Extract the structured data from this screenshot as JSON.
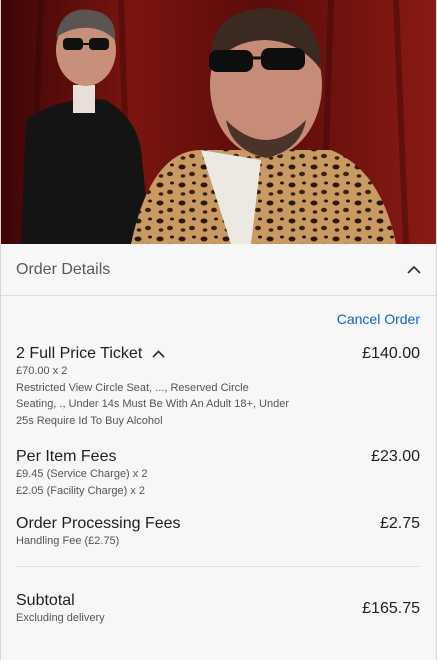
{
  "hero": {
    "image_name": "band-photo"
  },
  "order_details": {
    "title": "Order Details",
    "toggle_icon": "chevron-up-icon",
    "cancel_label": "Cancel Order"
  },
  "items": [
    {
      "title": "2 Full Price Ticket",
      "price": "£140.00",
      "lines": [
        "£70.00 x 2",
        "Restricted View Circle Seat, ..., Reserved Circle Seating, ., Under 14s Must Be With An Adult 18+, Under 25s Require Id To Buy Alcohol"
      ]
    },
    {
      "title": "Per Item Fees",
      "price": "£23.00",
      "lines": [
        "£9.45 (Service Charge) x 2",
        "£2.05 (Facility Charge) x 2"
      ]
    },
    {
      "title": "Order Processing Fees",
      "price": "£2.75",
      "lines": [
        "Handling Fee (£2.75)"
      ]
    }
  ],
  "subtotal": {
    "label": "Subtotal",
    "note": "Excluding delivery",
    "price": "£165.75"
  },
  "colors": {
    "link": "#0a66c2",
    "background": "#f7f7f7",
    "curtain": "#6e0f0c"
  }
}
